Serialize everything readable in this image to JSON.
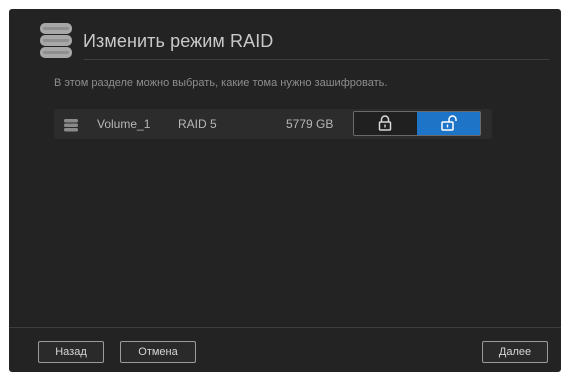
{
  "header": {
    "title": "Изменить режим RAID",
    "icon": "database-icon"
  },
  "description": "В этом разделе можно выбрать, какие тома нужно зашифровать.",
  "volume": {
    "name": "Volume_1",
    "raid": "RAID 5",
    "size": "5779 GB",
    "icon": "drive-icon",
    "encryption_toggle": {
      "options": [
        "locked",
        "unlocked"
      ],
      "selected": "unlocked",
      "active_color": "#1e74c6"
    }
  },
  "footer": {
    "back_label": "Назад",
    "cancel_label": "Отмена",
    "next_label": "Далее"
  }
}
